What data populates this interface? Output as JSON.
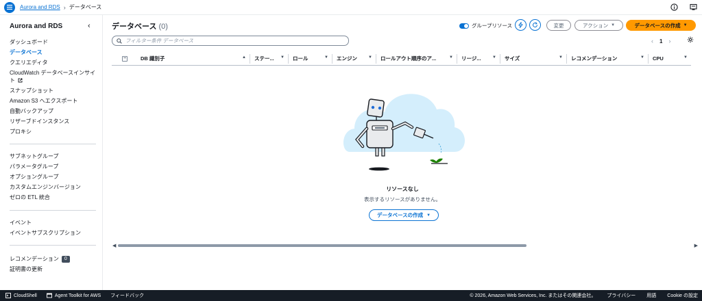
{
  "breadcrumb": {
    "service": "Aurora and RDS",
    "current": "データベース"
  },
  "sidebar": {
    "title": "Aurora and RDS",
    "group1": [
      {
        "label": "ダッシュボード"
      },
      {
        "label": "データベース",
        "active": true
      },
      {
        "label": "クエリエディタ"
      },
      {
        "label": "CloudWatch データベースインサイト",
        "external": true
      },
      {
        "label": "スナップショット"
      },
      {
        "label": "Amazon S3 へエクスポート"
      },
      {
        "label": "自動バックアップ"
      },
      {
        "label": "リザーブドインスタンス"
      },
      {
        "label": "プロキシ"
      }
    ],
    "group2": [
      {
        "label": "サブネットグループ"
      },
      {
        "label": "パラメータグループ"
      },
      {
        "label": "オプショングループ"
      },
      {
        "label": "カスタムエンジンバージョン"
      },
      {
        "label": "ゼロの ETL 統合"
      }
    ],
    "group3": [
      {
        "label": "イベント"
      },
      {
        "label": "イベントサブスクリプション"
      }
    ],
    "group4": [
      {
        "label": "レコメンデーション",
        "badge": "0"
      },
      {
        "label": "証明書の更新"
      }
    ]
  },
  "main": {
    "title": "データベース",
    "count": "(0)",
    "group_resources_label": "グループリソース",
    "modify_label": "変更",
    "actions_label": "アクション",
    "create_label": "データベースの作成",
    "search_placeholder": "フィルター条件 データベース",
    "page_number": "1"
  },
  "table": {
    "columns": [
      {
        "label": "DB 識別子",
        "sort": "▲",
        "width": 166
      },
      {
        "label": "ステー...",
        "sort": "▼",
        "width": 56
      },
      {
        "label": "ロール",
        "sort": "▼",
        "width": 64
      },
      {
        "label": "エンジン",
        "sort": "▼",
        "width": 64
      },
      {
        "label": "ロールアウト順序のア...",
        "sort": "▼",
        "width": 118
      },
      {
        "label": "リージ...",
        "sort": "▼",
        "width": 63
      },
      {
        "label": "サイズ",
        "sort": "▼",
        "width": 97
      },
      {
        "label": "レコメンデーション",
        "sort": "▼",
        "width": 119
      },
      {
        "label": "CPU",
        "sort": "▼",
        "width": 62
      }
    ]
  },
  "empty_state": {
    "title": "リソースなし",
    "description": "表示するリソースがありません。",
    "button_label": "データベースの作成"
  },
  "footer": {
    "cloudshell": "CloudShell",
    "agent_toolkit": "Agent Toolkit for AWS",
    "feedback": "フィードバック",
    "copyright": "© 2026, Amazon Web Services, Inc. またはその関連会社。",
    "privacy": "プライバシー",
    "terms": "用語",
    "cookies": "Cookie の設定"
  },
  "colors": {
    "accent": "#0972d3",
    "primary": "#ff9900",
    "footer_bg": "#161d26"
  }
}
